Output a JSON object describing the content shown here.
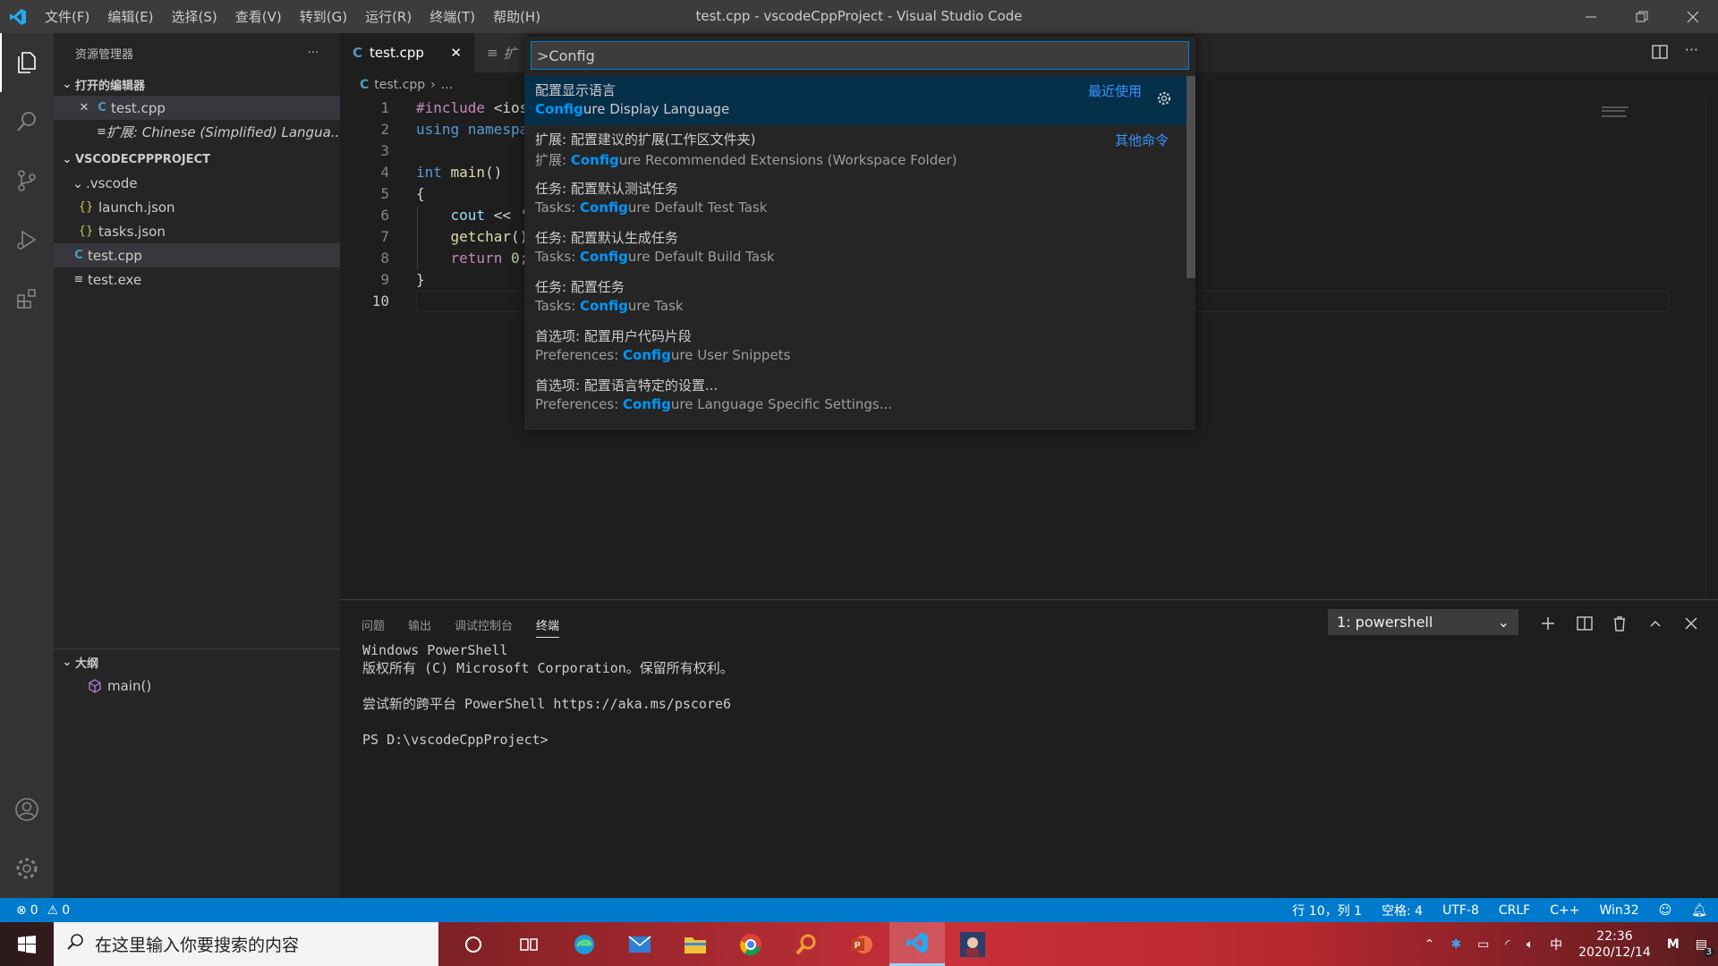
{
  "window": {
    "title": "test.cpp - vscodeCppProject - Visual Studio Code",
    "menu": [
      "文件(F)",
      "编辑(E)",
      "选择(S)",
      "查看(V)",
      "转到(G)",
      "运行(R)",
      "终端(T)",
      "帮助(H)"
    ]
  },
  "sidebar": {
    "header": "资源管理器",
    "more": "···",
    "open_editors_title": "打开的编辑器",
    "open_editors": [
      {
        "name": "test.cpp"
      },
      {
        "name": "扩展: Chinese (Simplified) Langua..."
      }
    ],
    "project_title": "VSCODECPPPROJECT",
    "tree": {
      "vscode_folder": ".vscode",
      "launch": "launch.json",
      "tasks": "tasks.json",
      "testcpp": "test.cpp",
      "testexe": "test.exe"
    },
    "outline_title": "大纲",
    "outline_item": "main()"
  },
  "tabs": {
    "active": "test.cpp",
    "inactive": "扩"
  },
  "breadcrumb": {
    "file": "test.cpp",
    "rest": "..."
  },
  "editor": {
    "lines": [
      "1",
      "2",
      "3",
      "4",
      "5",
      "6",
      "7",
      "8",
      "9",
      "10"
    ],
    "code": {
      "l1a": "#include ",
      "l1b": "<ios",
      "l2a": "using ",
      "l2b": "namespa",
      "l4a": "int ",
      "l4b": "main",
      "l4c": "()",
      "l5": "{",
      "l6a": "    cout ",
      "l6b": "<< '",
      "l7a": "    getchar",
      "l7b": "()",
      "l8a": "    return ",
      "l8b": "0;",
      "l9": "}"
    }
  },
  "palette": {
    "input": ">Config",
    "recent_label": "最近使用",
    "other_label": "其他命令",
    "items": [
      {
        "zh": "配置显示语言",
        "hl": "Config",
        "rest": "ure Display Language",
        "prefix": ""
      },
      {
        "zh": "扩展: 配置建议的扩展(工作区文件夹)",
        "prefix": "扩展: ",
        "hl": "Config",
        "rest": "ure Recommended Extensions (Workspace Folder)"
      },
      {
        "zh": "任务: 配置默认测试任务",
        "prefix": "Tasks: ",
        "hl": "Config",
        "rest": "ure Default Test Task"
      },
      {
        "zh": "任务: 配置默认生成任务",
        "prefix": "Tasks: ",
        "hl": "Config",
        "rest": "ure Default Build Task"
      },
      {
        "zh": "任务: 配置任务",
        "prefix": "Tasks: ",
        "hl": "Config",
        "rest": "ure Task"
      },
      {
        "zh": "首选项: 配置用户代码片段",
        "prefix": "Preferences: ",
        "hl": "Config",
        "rest": "ure User Snippets"
      },
      {
        "zh": "首选项: 配置语言特定的设置...",
        "prefix": "Preferences: ",
        "hl": "Config",
        "rest": "ure Language Specific Settings..."
      }
    ]
  },
  "panel": {
    "tabs": [
      "问题",
      "输出",
      "调试控制台",
      "终端"
    ],
    "terminal_select": "1: powershell",
    "terminal_lines": [
      "Windows PowerShell",
      "版权所有 (C) Microsoft Corporation。保留所有权利。",
      "",
      "尝试新的跨平台 PowerShell https://aka.ms/pscore6",
      "",
      "PS D:\\vscodeCppProject>"
    ]
  },
  "status": {
    "errors": "0",
    "warnings": "0",
    "position": "行 10，列 1",
    "spaces": "空格: 4",
    "encoding": "UTF-8",
    "eol": "CRLF",
    "language": "C++",
    "platform": "Win32"
  },
  "taskbar": {
    "search_placeholder": "在这里输入你要搜索的内容",
    "time": "22:36",
    "date": "2020/12/14",
    "ime": "中",
    "notif_count": "3"
  },
  "colors": {
    "accent": "#007acc",
    "highlight": "#0097fb",
    "link": "#3794ff"
  }
}
